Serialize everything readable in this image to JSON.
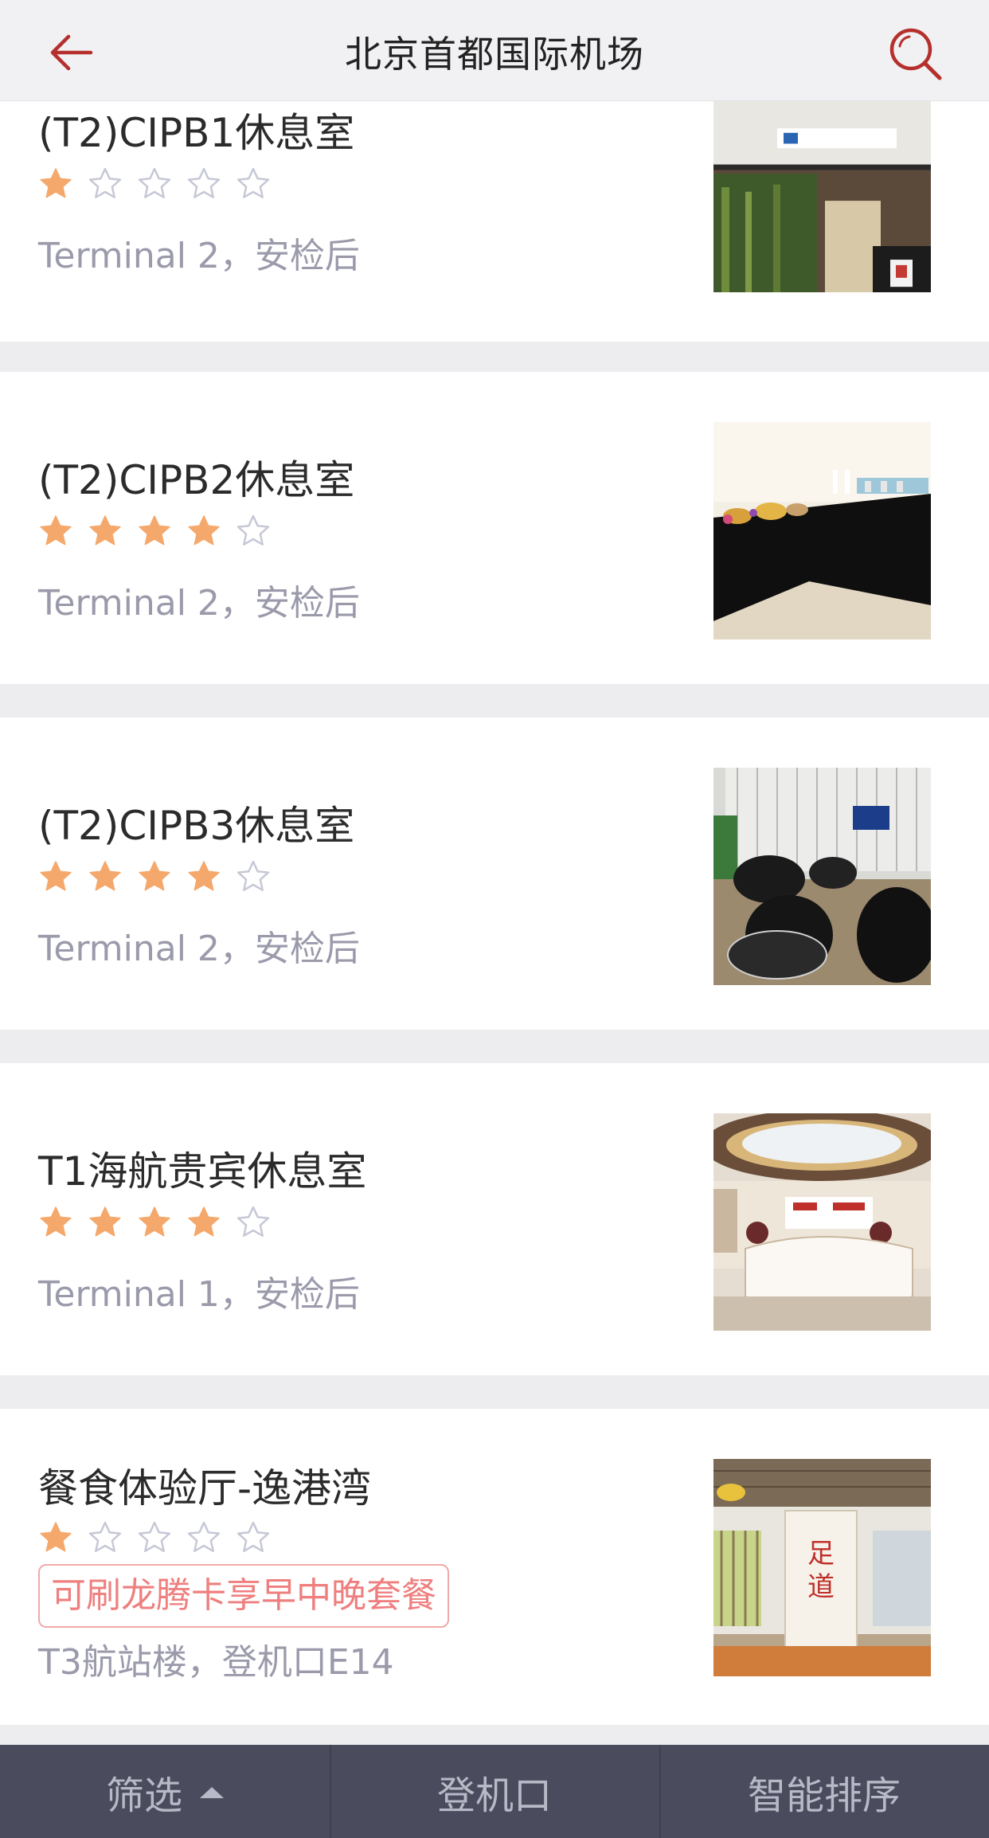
{
  "header": {
    "title": "北京首都国际机场",
    "back_icon": "arrow-left-icon",
    "search_icon": "search-icon",
    "accent_color": "#b5302c"
  },
  "colors": {
    "star_filled": "#f5a86b",
    "star_empty": "#c6c8d6"
  },
  "lounges": [
    {
      "name": "(T2)CIPB1休息室",
      "rating": 1,
      "max_rating": 5,
      "location": "Terminal 2，安检后",
      "promo": ""
    },
    {
      "name": "(T2)CIPB2休息室",
      "rating": 4,
      "max_rating": 5,
      "location": "Terminal 2，安检后",
      "promo": ""
    },
    {
      "name": "(T2)CIPB3休息室",
      "rating": 4,
      "max_rating": 5,
      "location": "Terminal 2，安检后",
      "promo": ""
    },
    {
      "name": "T1海航贵宾休息室",
      "rating": 4,
      "max_rating": 5,
      "location": "Terminal 1，安检后",
      "promo": ""
    },
    {
      "name": "餐食体验厅-逸港湾",
      "rating": 1,
      "max_rating": 5,
      "location": "T3航站楼，登机口E14",
      "promo": "可刷龙腾卡享早中晚套餐"
    }
  ],
  "tabbar": {
    "filter_label": "筛选",
    "gate_label": "登机口",
    "sort_label": "智能排序"
  }
}
